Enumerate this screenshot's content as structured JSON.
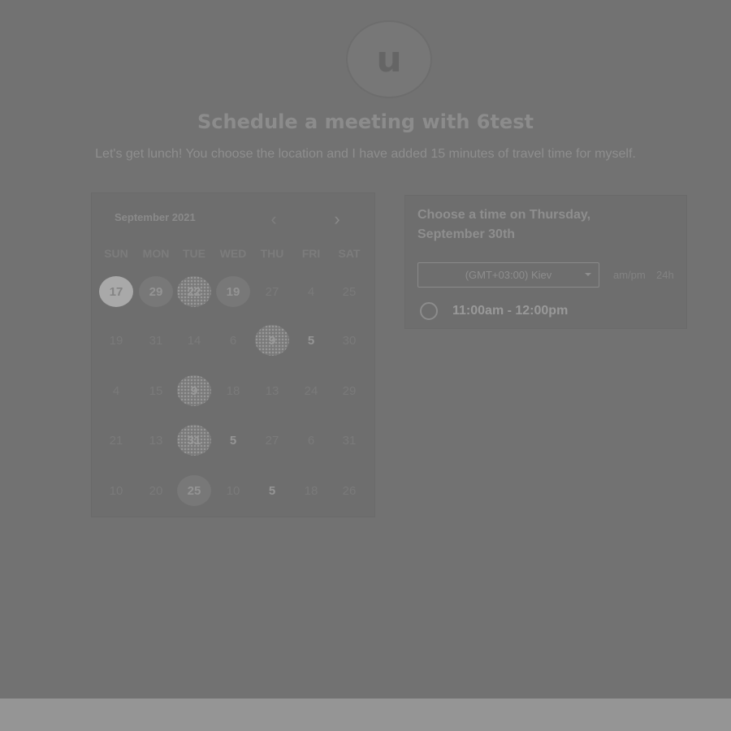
{
  "header": {
    "avatar_letter": "u",
    "title": "Schedule a meeting with 6test",
    "subtitle": "Let's get lunch! You choose the location and I have added 15 minutes of travel time for myself."
  },
  "calendar": {
    "month_label": "September 2021",
    "prev_icon": "‹",
    "next_icon": "›",
    "weekdays": [
      "SUN",
      "MON",
      "TUE",
      "WED",
      "THU",
      "FRI",
      "SAT"
    ],
    "weeks": [
      [
        "17",
        "29",
        "22",
        "19",
        "27",
        "4",
        "25"
      ],
      [
        "19",
        "31",
        "14",
        "6",
        "9",
        "5",
        "30"
      ],
      [
        "4",
        "15",
        "9",
        "18",
        "13",
        "24",
        "29"
      ],
      [
        "21",
        "13",
        "31",
        "5",
        "27",
        "6",
        "31"
      ],
      [
        "10",
        "20",
        "25",
        "10",
        "5",
        "18",
        "26"
      ]
    ],
    "states": [
      [
        "selected",
        "avail",
        "pattern",
        "avail",
        "none",
        "none",
        "none"
      ],
      [
        "none",
        "none",
        "none",
        "none",
        "pattern",
        "avail-text",
        "none"
      ],
      [
        "none",
        "none",
        "pattern",
        "none",
        "none",
        "none",
        "none"
      ],
      [
        "none",
        "none",
        "pattern",
        "avail-text",
        "none",
        "none",
        "none"
      ],
      [
        "none",
        "none",
        "avail",
        "none",
        "avail-text",
        "none",
        "none"
      ]
    ]
  },
  "times": {
    "heading": "Choose a time on Thursday, September 30th",
    "timezone_value": "(GMT+03:00) Kiev",
    "format_ampm": "am/pm",
    "format_24h": "24h",
    "slots": [
      {
        "label": "11:00am - 12:00pm"
      }
    ]
  }
}
